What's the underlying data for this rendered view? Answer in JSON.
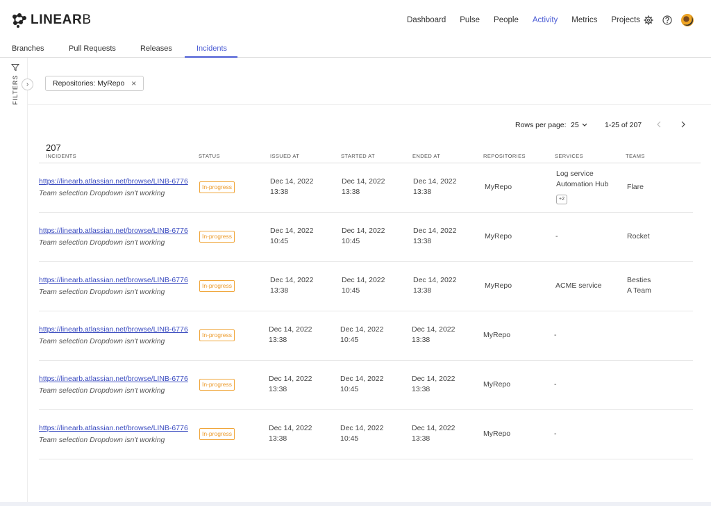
{
  "brand": {
    "name_bold": "LINEAR",
    "name_light": "B"
  },
  "nav": [
    "Dashboard",
    "Pulse",
    "People",
    "Activity",
    "Metrics",
    "Projects"
  ],
  "nav_active": "Activity",
  "tabs": [
    "Branches",
    "Pull Requests",
    "Releases",
    "Incidents"
  ],
  "tab_active": "Incidents",
  "rail": {
    "label": "FILTERS"
  },
  "filter_chip": {
    "label": "Repositories: MyRepo",
    "remove": "×"
  },
  "pager": {
    "rows_label": "Rows per page:",
    "rows_value": "25",
    "range": "1-25 of 207"
  },
  "table": {
    "count": "207",
    "headers": [
      "INCIDENTS",
      "STATUS",
      "ISSUED AT",
      "STARTED AT",
      "ENDED AT",
      "REPOSITORIES",
      "SERVICES",
      "TEAMS"
    ],
    "rows": [
      {
        "link": "https://linearb.atlassian.net/browse/LINB-6776",
        "desc": "Team selection Dropdown isn't working",
        "status": "In-progress",
        "issued_date": "Dec 14, 2022",
        "issued_time": "13:38",
        "started_date": "Dec 14, 2022",
        "started_time": "13:38",
        "ended_date": "Dec 14, 2022",
        "ended_time": "13:38",
        "repo": "MyRepo",
        "service1": "Log service",
        "service2": "Automation Hub",
        "more": "+2",
        "team1": "Flare",
        "team2": ""
      },
      {
        "link": "https://linearb.atlassian.net/browse/LINB-6776",
        "desc": "Team selection Dropdown isn't working",
        "status": "In-progress",
        "issued_date": "Dec 14, 2022",
        "issued_time": "10:45",
        "started_date": "Dec 14, 2022",
        "started_time": "10:45",
        "ended_date": "Dec 14, 2022",
        "ended_time": "13:38",
        "repo": "MyRepo",
        "service1": "-",
        "service2": "",
        "more": "",
        "team1": "Rocket",
        "team2": ""
      },
      {
        "link": "https://linearb.atlassian.net/browse/LINB-6776",
        "desc": "Team selection Dropdown isn't working",
        "status": "In-progress",
        "issued_date": "Dec 14, 2022",
        "issued_time": "13:38",
        "started_date": "Dec 14, 2022",
        "started_time": "10:45",
        "ended_date": "Dec 14, 2022",
        "ended_time": "13:38",
        "repo": "MyRepo",
        "service1": "ACME service",
        "service2": "",
        "more": "",
        "team1": "Besties",
        "team2": "A Team"
      },
      {
        "link": "https://linearb.atlassian.net/browse/LINB-6776",
        "desc": "Team selection Dropdown isn't working",
        "status": "In-progress",
        "issued_date": "Dec 14, 2022",
        "issued_time": "13:38",
        "started_date": "Dec 14, 2022",
        "started_time": "10:45",
        "ended_date": "Dec 14, 2022",
        "ended_time": "13:38",
        "repo": "MyRepo",
        "service1": "-",
        "service2": "",
        "more": "",
        "team1": "",
        "team2": ""
      },
      {
        "link": "https://linearb.atlassian.net/browse/LINB-6776",
        "desc": "Team selection Dropdown isn't working",
        "status": "In-progress",
        "issued_date": "Dec 14, 2022",
        "issued_time": "13:38",
        "started_date": "Dec 14, 2022",
        "started_time": "10:45",
        "ended_date": "Dec 14, 2022",
        "ended_time": "13:38",
        "repo": "MyRepo",
        "service1": "-",
        "service2": "",
        "more": "",
        "team1": "",
        "team2": ""
      },
      {
        "link": "https://linearb.atlassian.net/browse/LINB-6776",
        "desc": "Team selection Dropdown isn't working",
        "status": "In-progress",
        "issued_date": "Dec 14, 2022",
        "issued_time": "13:38",
        "started_date": "Dec 14, 2022",
        "started_time": "10:45",
        "ended_date": "Dec 14, 2022",
        "ended_time": "13:38",
        "repo": "MyRepo",
        "service1": "-",
        "service2": "",
        "more": "",
        "team1": "",
        "team2": ""
      }
    ]
  },
  "colors": {
    "accent": "#4a5bd4",
    "status_orange": "#ec9a2a",
    "link": "#3b4cc0"
  }
}
